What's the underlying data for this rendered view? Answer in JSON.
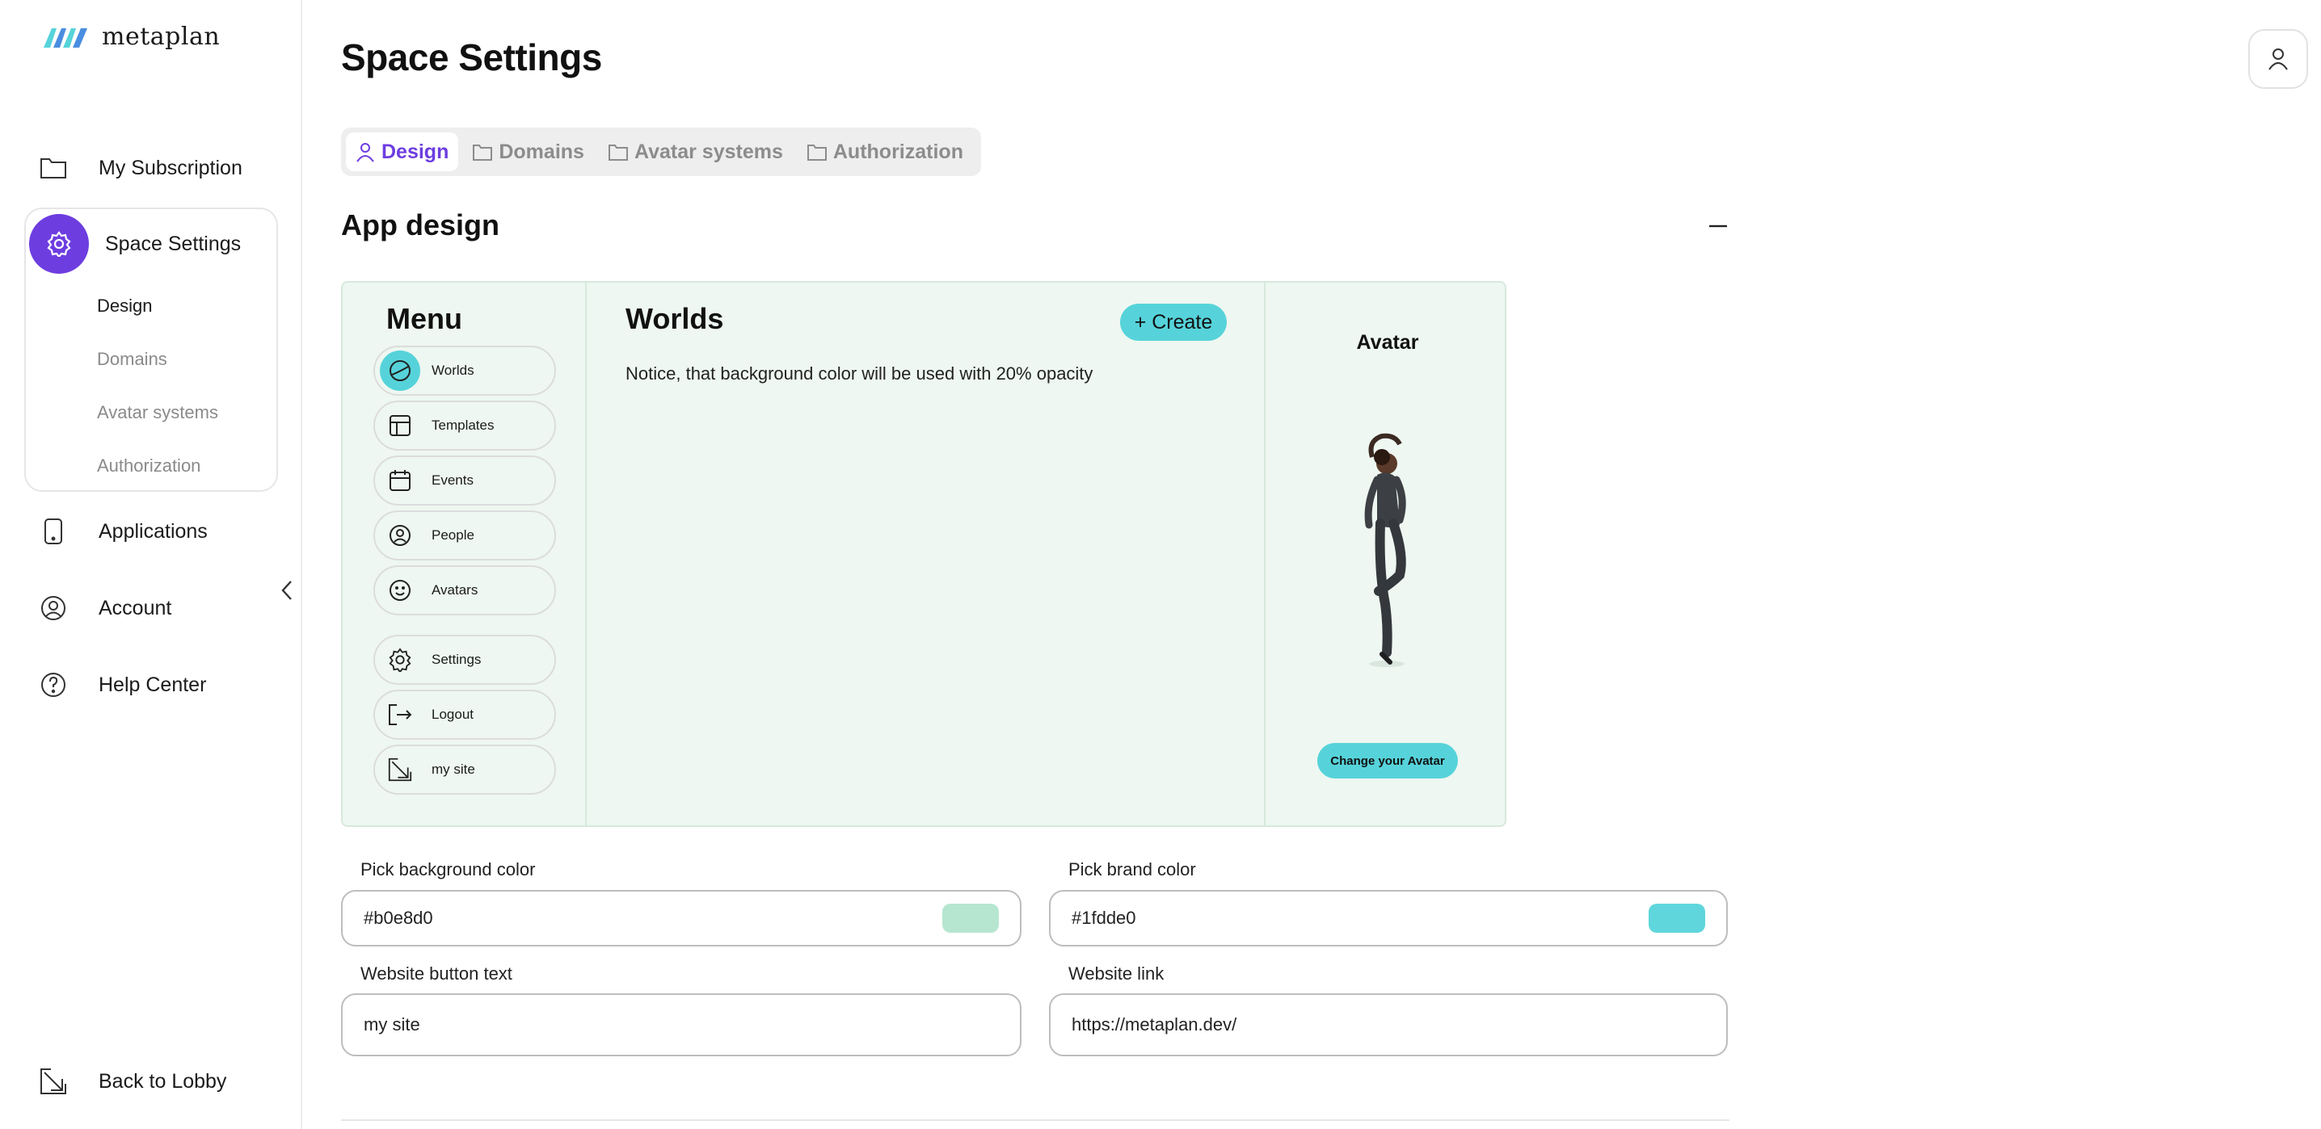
{
  "app": {
    "name": "metaplan"
  },
  "sidebar": {
    "items": [
      {
        "label": "My Subscription",
        "icon": "folder-icon"
      },
      {
        "label": "Space Settings",
        "icon": "gear-icon"
      },
      {
        "label": "Applications",
        "icon": "phone-icon"
      },
      {
        "label": "Account",
        "icon": "user-circle-icon"
      },
      {
        "label": "Help Center",
        "icon": "help-icon"
      }
    ],
    "sub_items": [
      "Design",
      "Domains",
      "Avatar systems",
      "Authorization"
    ],
    "back_label": "Back to Lobby"
  },
  "header": {
    "title": "Space Settings"
  },
  "tabs": [
    "Design",
    "Domains",
    "Avatar systems",
    "Authorization"
  ],
  "section": {
    "title": "App design"
  },
  "preview": {
    "menu_title": "Menu",
    "menu_items": [
      "Worlds",
      "Templates",
      "Events",
      "People",
      "Avatars",
      "Settings",
      "Logout",
      "my site"
    ],
    "main_title": "Worlds",
    "create_label": "+ Create",
    "notice": "Notice, that background color will be used with 20% opacity",
    "avatar_title": "Avatar",
    "change_avatar_label": "Change your Avatar"
  },
  "form": {
    "bg_color_label": "Pick background color",
    "bg_color_value": "#b0e8d0",
    "brand_color_label": "Pick brand color",
    "brand_color_value": "#1fdde0",
    "button_text_label": "Website button text",
    "button_text_value": "my site",
    "link_label": "Website link",
    "link_value": "https://metaplan.dev/"
  },
  "colors": {
    "accent": "#6d3de0",
    "brand": "#56d3da",
    "background": "#eef7f1",
    "bg_swatch": "#b6e6cf",
    "brand_swatch": "#5fd6dc"
  }
}
